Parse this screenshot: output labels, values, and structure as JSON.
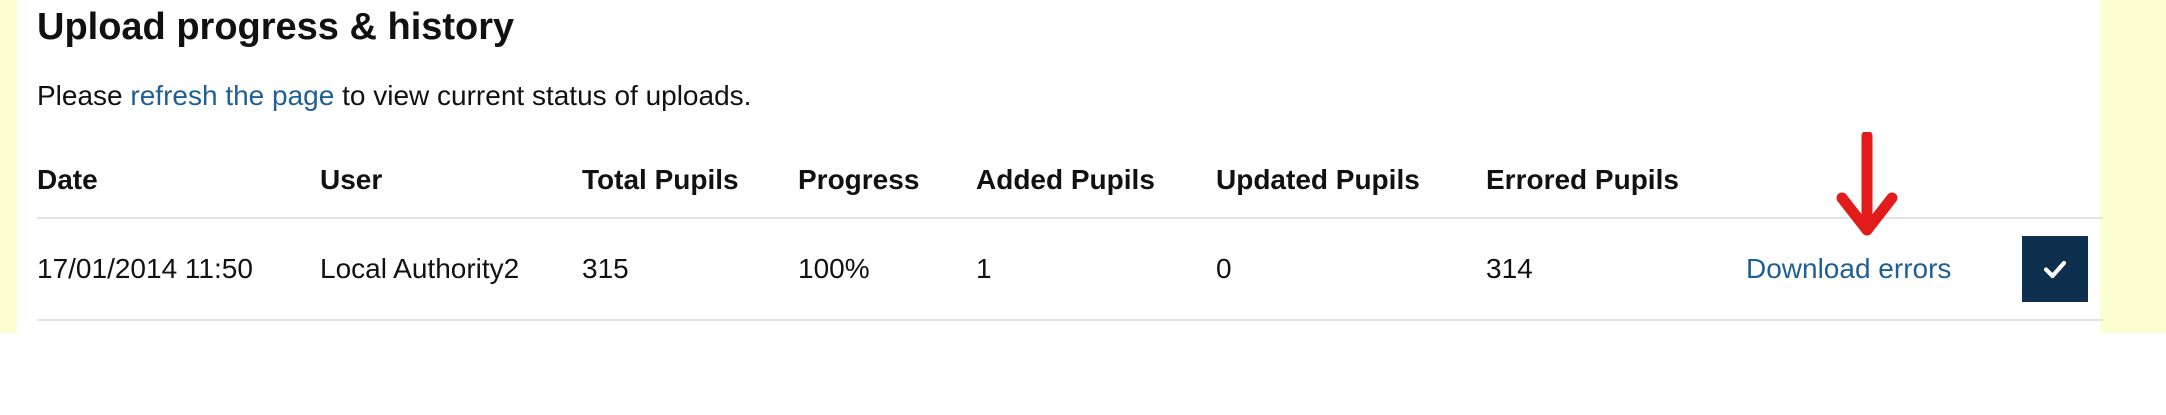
{
  "heading": "Upload progress & history",
  "intro": {
    "before": "Please ",
    "link": "refresh the page",
    "after": " to view current status of uploads."
  },
  "table": {
    "headers": [
      "Date",
      "User",
      "Total Pupils",
      "Progress",
      "Added Pupils",
      "Updated Pupils",
      "Errored Pupils"
    ],
    "rows": [
      {
        "date": "17/01/2014 11:50",
        "user": "Local Authority2",
        "total_pupils": "315",
        "progress": "100%",
        "added_pupils": "1",
        "updated_pupils": "0",
        "errored_pupils": "314",
        "action_label": "Download errors"
      }
    ]
  },
  "icons": {
    "status": "check-icon",
    "annotation": "red-down-arrow-icon"
  },
  "colors": {
    "page_border": "#fefed3",
    "link": "#1f5f96",
    "status_button": "#0e2f4d",
    "annotation_arrow": "#e21b1b"
  }
}
